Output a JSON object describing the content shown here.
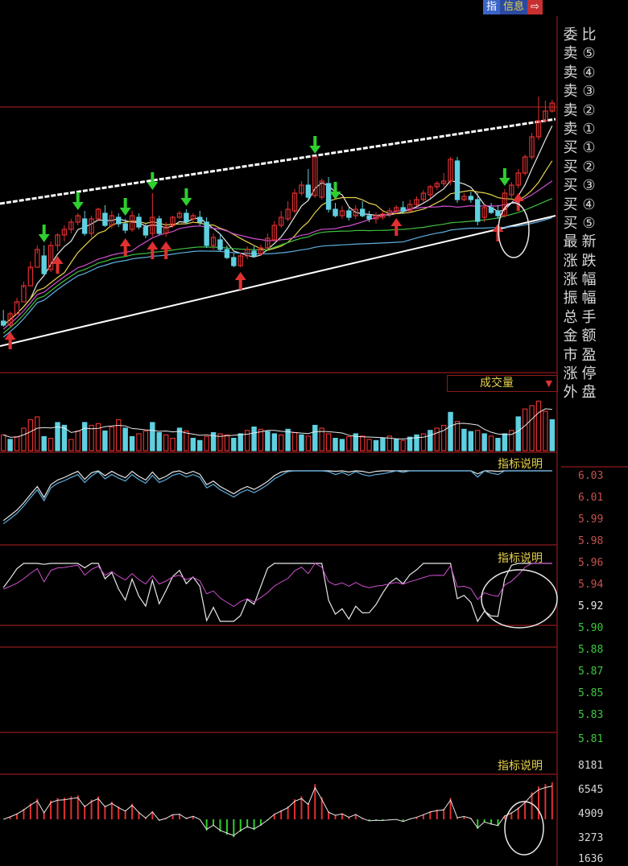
{
  "tabs": [
    {
      "label": "指",
      "color": "#3a64c8"
    },
    {
      "label": "信息",
      "color": "#2b4aa0"
    },
    {
      "label": "⇨",
      "color": "#c83030"
    }
  ],
  "side_panel": {
    "left_labels": [
      "委",
      "卖",
      "卖",
      "卖",
      "卖",
      "卖",
      "买",
      "买",
      "买",
      "买",
      "买",
      "最",
      "涨",
      "涨",
      "振",
      "总",
      "金",
      "市",
      "涨",
      "外"
    ],
    "right_labels": [
      "比",
      "⑤",
      "④",
      "③",
      "②",
      "①",
      "①",
      "②",
      "③",
      "④",
      "⑤",
      "新",
      "跌",
      "幅",
      "幅",
      "手",
      "额",
      "盈",
      "停",
      "盘"
    ]
  },
  "volume_panel_title": "成交量",
  "indicator_titles": [
    "指标说明",
    "指标说明",
    "指标说明"
  ],
  "price_scale": [
    "6.03",
    "6.01",
    "5.99",
    "5.98",
    "5.96",
    "5.94",
    "5.92",
    "5.90",
    "5.88",
    "5.87",
    "5.85",
    "5.83",
    "5.81"
  ],
  "highlight_price": "5.92",
  "volume_scale": [
    "8181",
    "6545",
    "4909",
    "3273",
    "1636"
  ],
  "colors": {
    "up": "#e03030",
    "down": "#5fd0e0",
    "buy_arrow": "#e03030",
    "sell_arrow": "#2ecf2e",
    "trendline": "#ffffff",
    "panel_border": "#8a1a1a",
    "title_text": "#e6d24a"
  },
  "chart_data": {
    "type": "candlestick",
    "candles": [
      [
        399,
        404,
        385,
        406
      ],
      [
        404,
        390,
        387,
        406
      ],
      [
        390,
        375,
        370,
        378
      ],
      [
        375,
        355,
        350,
        358
      ],
      [
        355,
        332,
        325,
        335
      ],
      [
        332,
        310,
        305,
        315
      ],
      [
        318,
        340,
        305,
        342
      ],
      [
        335,
        305,
        300,
        338
      ],
      [
        305,
        292,
        290,
        312
      ],
      [
        292,
        285,
        280,
        300
      ],
      [
        285,
        276,
        272,
        290
      ],
      [
        276,
        268,
        265,
        280
      ],
      [
        272,
        290,
        262,
        293
      ],
      [
        290,
        272,
        268,
        295
      ],
      [
        272,
        260,
        258,
        275
      ],
      [
        265,
        280,
        255,
        282
      ],
      [
        280,
        268,
        262,
        284
      ],
      [
        270,
        278,
        265,
        282
      ],
      [
        278,
        286,
        272,
        290
      ],
      [
        285,
        268,
        262,
        288
      ],
      [
        270,
        282,
        265,
        285
      ],
      [
        282,
        292,
        277,
        296
      ],
      [
        290,
        270,
        240,
        294
      ],
      [
        272,
        290,
        268,
        292
      ],
      [
        290,
        282,
        276,
        294
      ],
      [
        280,
        270,
        268,
        283
      ],
      [
        270,
        265,
        262,
        272
      ],
      [
        265,
        275,
        260,
        278
      ],
      [
        272,
        268,
        265,
        276
      ],
      [
        270,
        276,
        262,
        280
      ],
      [
        276,
        305,
        270,
        308
      ],
      [
        305,
        295,
        290,
        310
      ],
      [
        298,
        310,
        290,
        312
      ],
      [
        310,
        320,
        305,
        322
      ],
      [
        320,
        330,
        315,
        332
      ],
      [
        330,
        318,
        314,
        332
      ],
      [
        318,
        310,
        306,
        322
      ],
      [
        312,
        318,
        306,
        320
      ],
      [
        315,
        308,
        304,
        318
      ],
      [
        308,
        296,
        290,
        310
      ],
      [
        298,
        280,
        275,
        300
      ],
      [
        280,
        270,
        262,
        283
      ],
      [
        272,
        260,
        250,
        275
      ],
      [
        262,
        240,
        235,
        265
      ],
      [
        240,
        230,
        225,
        243
      ],
      [
        230,
        245,
        210,
        248
      ],
      [
        243,
        195,
        195,
        246
      ],
      [
        245,
        225,
        222,
        248
      ],
      [
        228,
        260,
        220,
        264
      ],
      [
        260,
        268,
        252,
        270
      ],
      [
        268,
        262,
        256,
        272
      ],
      [
        262,
        270,
        258,
        274
      ],
      [
        268,
        260,
        255,
        272
      ],
      [
        260,
        268,
        250,
        270
      ],
      [
        268,
        272,
        262,
        276
      ],
      [
        272,
        268,
        264,
        278
      ],
      [
        270,
        266,
        262,
        273
      ],
      [
        266,
        262,
        258,
        270
      ],
      [
        262,
        258,
        255,
        265
      ],
      [
        258,
        262,
        250,
        266
      ],
      [
        262,
        254,
        248,
        264
      ],
      [
        254,
        248,
        244,
        256
      ],
      [
        248,
        240,
        236,
        252
      ],
      [
        242,
        232,
        230,
        246
      ],
      [
        232,
        228,
        225,
        236
      ],
      [
        228,
        225,
        215,
        232
      ],
      [
        225,
        198,
        195,
        230
      ],
      [
        200,
        248,
        195,
        252
      ],
      [
        248,
        244,
        240,
        250
      ],
      [
        244,
        248,
        238,
        252
      ],
      [
        248,
        275,
        240,
        280
      ],
      [
        270,
        258,
        254,
        276
      ],
      [
        258,
        264,
        252,
        266
      ],
      [
        262,
        268,
        255,
        272
      ],
      [
        268,
        240,
        235,
        270
      ],
      [
        242,
        230,
        226,
        246
      ],
      [
        230,
        215,
        210,
        234
      ],
      [
        215,
        195,
        192,
        218
      ],
      [
        195,
        170,
        165,
        198
      ],
      [
        170,
        150,
        120,
        174
      ],
      [
        150,
        138,
        125,
        152
      ],
      [
        138,
        128,
        124,
        140
      ]
    ],
    "trendlines": [
      {
        "name": "upper",
        "from_index": 0,
        "to_index": 81,
        "from_value": 253,
        "to_value": 148
      },
      {
        "name": "lower",
        "from_index": 0,
        "to_index": 81,
        "from_value": 430,
        "to_value": 268
      }
    ],
    "buy_signals": [
      1,
      8,
      18,
      22,
      24,
      35,
      58,
      73,
      76
    ],
    "sell_signals": [
      6,
      11,
      18,
      22,
      27,
      46,
      49,
      74
    ],
    "volume": [
      28,
      20,
      25,
      40,
      55,
      60,
      25,
      22,
      50,
      45,
      20,
      35,
      50,
      45,
      48,
      35,
      42,
      55,
      40,
      25,
      30,
      35,
      50,
      32,
      28,
      22,
      40,
      35,
      22,
      18,
      25,
      32,
      30,
      28,
      22,
      30,
      36,
      42,
      38,
      34,
      30,
      28,
      38,
      32,
      28,
      26,
      45,
      40,
      30,
      22,
      20,
      25,
      30,
      26,
      20,
      18,
      22,
      26,
      20,
      18,
      24,
      28,
      30,
      36,
      40,
      45,
      68,
      52,
      38,
      34,
      36,
      30,
      26,
      22,
      30,
      36,
      60,
      74,
      80,
      88,
      70,
      55
    ],
    "volume_up": [
      true,
      false,
      true,
      true,
      true,
      true,
      false,
      true,
      false,
      false,
      true,
      true,
      false,
      true,
      true,
      false,
      true,
      true,
      false,
      false,
      true,
      true,
      false,
      false,
      true,
      true,
      false,
      true,
      false,
      false,
      true,
      false,
      true,
      true,
      false,
      false,
      true,
      false,
      true,
      false,
      false,
      true,
      false,
      true,
      false,
      true,
      false,
      true,
      true,
      false,
      false,
      true,
      false,
      true,
      true,
      false,
      false,
      true,
      false,
      true,
      false,
      false,
      true,
      false,
      true,
      true,
      false,
      true,
      false,
      false,
      true,
      false,
      true,
      false,
      false,
      true,
      false,
      true,
      true,
      true,
      true,
      false
    ]
  }
}
